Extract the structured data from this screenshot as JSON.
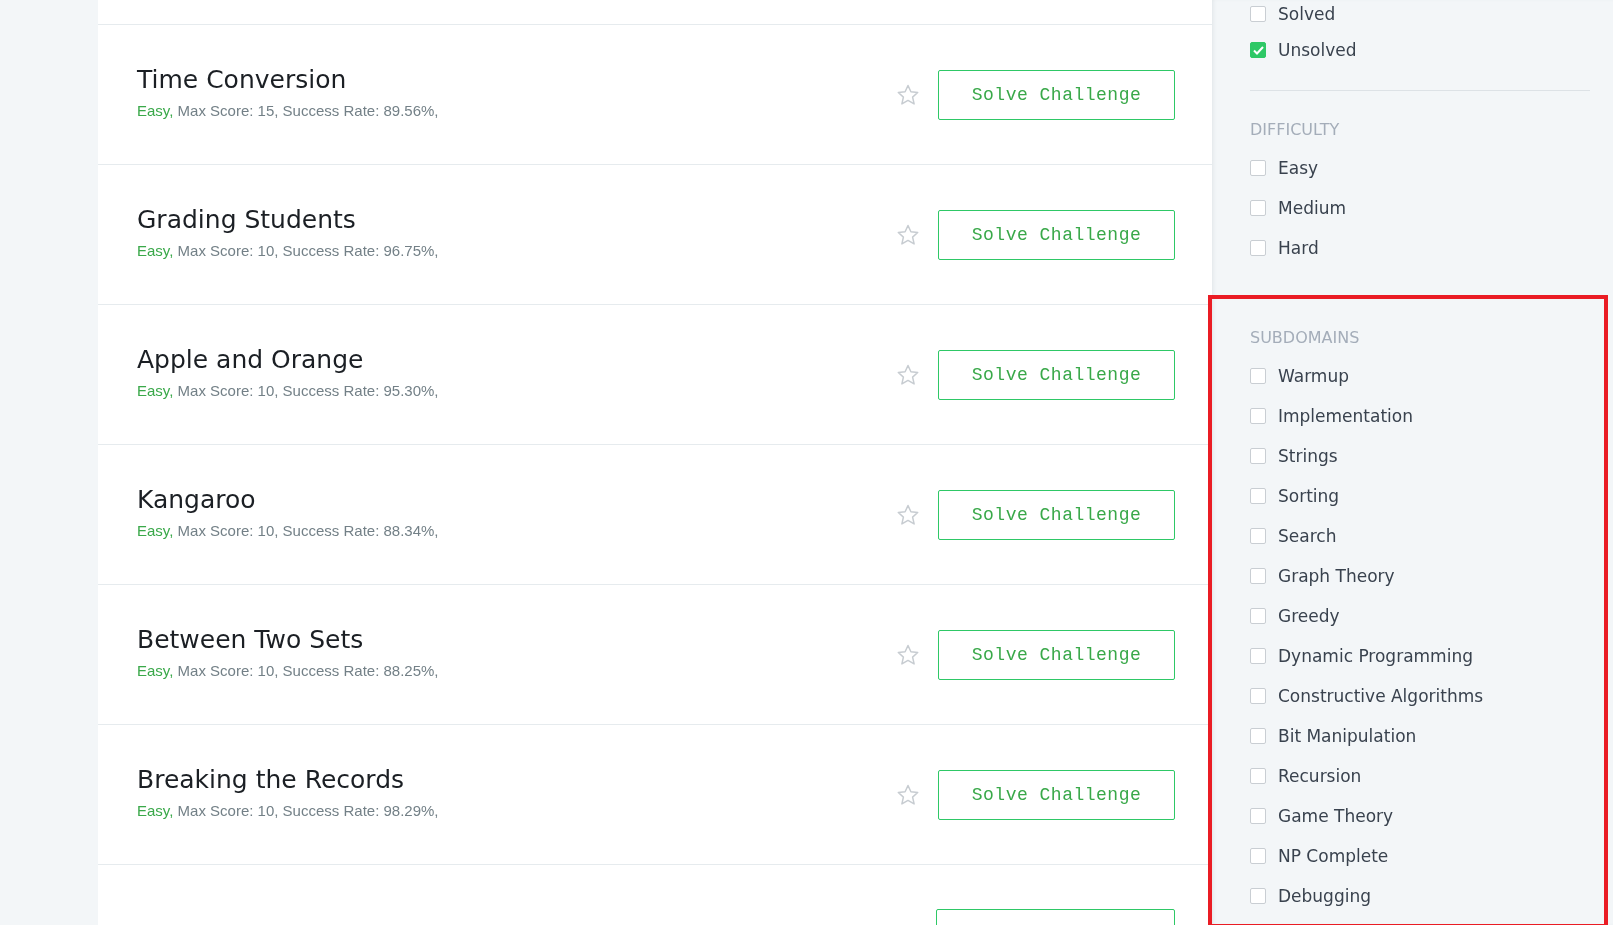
{
  "challenges": [
    {
      "title": "Time Conversion",
      "difficulty": "Easy,",
      "details": " Max Score: 15, Success Rate: 89.56%,",
      "starred": false,
      "button": "Solve Challenge"
    },
    {
      "title": "Grading Students",
      "difficulty": "Easy,",
      "details": " Max Score: 10, Success Rate: 96.75%,",
      "starred": false,
      "button": "Solve Challenge"
    },
    {
      "title": "Apple and Orange",
      "difficulty": "Easy,",
      "details": " Max Score: 10, Success Rate: 95.30%,",
      "starred": false,
      "button": "Solve Challenge"
    },
    {
      "title": "Kangaroo",
      "difficulty": "Easy,",
      "details": " Max Score: 10, Success Rate: 88.34%,",
      "starred": false,
      "button": "Solve Challenge"
    },
    {
      "title": "Between Two Sets",
      "difficulty": "Easy,",
      "details": " Max Score: 10, Success Rate: 88.25%,",
      "starred": false,
      "button": "Solve Challenge"
    },
    {
      "title": "Breaking the Records",
      "difficulty": "Easy,",
      "details": " Max Score: 10, Success Rate: 98.29%,",
      "starred": false,
      "button": "Solve Challenge"
    }
  ],
  "filters": [
    {
      "highlighted": false,
      "options": [
        {
          "label": "Solved",
          "checked": false
        },
        {
          "label": "Unsolved",
          "checked": true
        }
      ]
    },
    {
      "heading": "DIFFICULTY",
      "highlighted": false,
      "options": [
        {
          "label": "Easy",
          "checked": false
        },
        {
          "label": "Medium",
          "checked": false
        },
        {
          "label": "Hard",
          "checked": false
        }
      ]
    },
    {
      "heading": "SUBDOMAINS",
      "highlighted": true,
      "options": [
        {
          "label": "Warmup",
          "checked": false
        },
        {
          "label": "Implementation",
          "checked": false
        },
        {
          "label": "Strings",
          "checked": false
        },
        {
          "label": "Sorting",
          "checked": false
        },
        {
          "label": "Search",
          "checked": false
        },
        {
          "label": "Graph Theory",
          "checked": false
        },
        {
          "label": "Greedy",
          "checked": false
        },
        {
          "label": "Dynamic Programming",
          "checked": false
        },
        {
          "label": "Constructive Algorithms",
          "checked": false
        },
        {
          "label": "Bit Manipulation",
          "checked": false
        },
        {
          "label": "Recursion",
          "checked": false
        },
        {
          "label": "Game Theory",
          "checked": false
        },
        {
          "label": "NP Complete",
          "checked": false
        },
        {
          "label": "Debugging",
          "checked": false
        }
      ]
    }
  ]
}
